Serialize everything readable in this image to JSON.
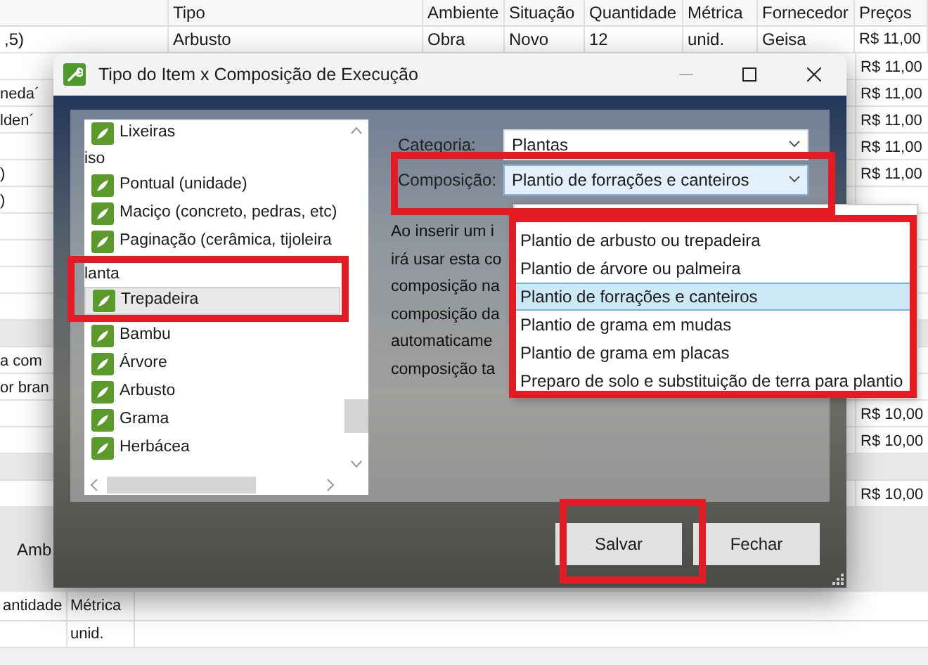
{
  "background_table": {
    "columns": [
      "Tipo",
      "Ambiente",
      "Situação",
      "Quantidade",
      "Métrica",
      "Fornecedor",
      "Preços"
    ],
    "first_row": [
      ",5)",
      "Arbusto",
      "Obra",
      "Novo",
      "12",
      "unid.",
      "Geisa",
      "R$ 11,00"
    ],
    "rows": [
      {
        "kind": "row",
        "price": "R$ 11,00"
      },
      {
        "kind": "row",
        "column_1": "neda´",
        "price": "R$ 11,00"
      },
      {
        "kind": "row",
        "column_1": "lden´",
        "price": "R$ 11,00"
      },
      {
        "kind": "row",
        "price": "R$ 11,00"
      },
      {
        "kind": "row",
        "column_1": ")",
        "price": "R$ 11,00"
      },
      {
        "kind": "row",
        "column_1": ")"
      },
      {
        "kind": "row"
      },
      {
        "kind": "row"
      },
      {
        "kind": "row"
      },
      {
        "kind": "row"
      },
      {
        "kind": "band"
      },
      {
        "kind": "row",
        "column_1": "a com"
      },
      {
        "kind": "row",
        "column_1": "or bran"
      },
      {
        "kind": "row",
        "price": "R$ 10,00"
      },
      {
        "kind": "row",
        "price": "R$ 10,00"
      },
      {
        "kind": "band"
      },
      {
        "kind": "row",
        "price": "R$ 10,00"
      }
    ],
    "panel_label": "Amb",
    "bottom_table": {
      "columns": [
        "antidade",
        "Métrica"
      ],
      "rows": [
        [
          "",
          "unid."
        ]
      ]
    }
  },
  "dialog": {
    "title": "Tipo do Item x Composição de Execução",
    "tree": [
      {
        "label": "Lixeiras",
        "selected": false
      },
      {
        "label": "iso",
        "children": [
          {
            "label": "Pontual (unidade)",
            "selected": false
          },
          {
            "label": "Maciço (concreto, pedras, etc)",
            "selected": false
          },
          {
            "label": "Paginação (cerâmica, tijoleira",
            "selected": false
          }
        ]
      },
      {
        "label": "lanta",
        "children": [
          {
            "label": "Trepadeira",
            "selected": true
          },
          {
            "label": "Bambu",
            "selected": false
          },
          {
            "label": "Árvore",
            "selected": false
          },
          {
            "label": "Arbusto",
            "selected": false
          },
          {
            "label": "Grama",
            "selected": false
          },
          {
            "label": "Herbácea",
            "selected": false
          }
        ]
      }
    ],
    "categoria": {
      "label": "Categoria:",
      "value": "Plantas"
    },
    "composicao": {
      "label": "Composição:",
      "value": "Plantio de forrações e canteiros",
      "expanded": true
    },
    "description_lines": [
      "Ao inserir um i",
      "irá usar esta co",
      "composição na",
      "composição da",
      "automaticame",
      "composição ta"
    ],
    "dropdown_options": [
      {
        "label": "Plantio de arbusto ou trepadeira",
        "selected": false
      },
      {
        "label": "Plantio de árvore ou palmeira",
        "selected": false
      },
      {
        "label": "Plantio de forrações e canteiros",
        "selected": true
      },
      {
        "label": "Plantio de grama em mudas",
        "selected": false
      },
      {
        "label": "Plantio de grama em placas",
        "selected": false
      },
      {
        "label": "Preparo de solo e substituição de terra para plantio",
        "selected": false
      }
    ],
    "buttons": [
      "Salvar",
      "Fechar"
    ]
  }
}
